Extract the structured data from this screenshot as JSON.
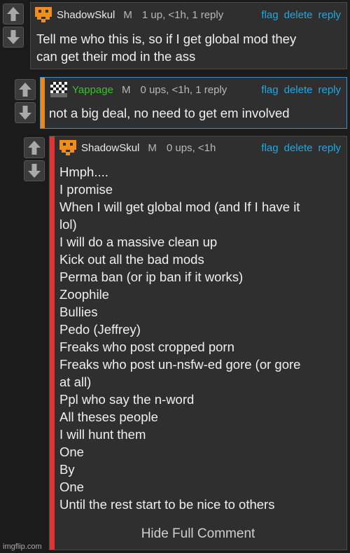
{
  "colors": {
    "link": "#1fa7e6",
    "shadowskul_name": "#e8e8e8",
    "yappage_name": "#3bbf2f",
    "stripe_c2": "#e68a1f",
    "stripe_c3": "#e23232"
  },
  "icons": {
    "upvote": "up-arrow-icon",
    "downvote": "down-arrow-icon"
  },
  "comments": [
    {
      "username": "ShadowSkul",
      "mod_badge": "M",
      "meta": "1 up, <1h, 1 reply",
      "actions": {
        "flag": "flag",
        "delete": "delete",
        "reply": "reply"
      },
      "lines": [
        "Tell me who this is, so if I get global mod they",
        "can get their mod in the ass"
      ]
    },
    {
      "username": "Yappage",
      "mod_badge": "M",
      "meta": "0 ups, <1h, 1 reply",
      "actions": {
        "flag": "flag",
        "delete": "delete",
        "reply": "reply"
      },
      "lines": [
        "not a big deal, no need to get em involved"
      ]
    },
    {
      "username": "ShadowSkul",
      "mod_badge": "M",
      "meta": "0 ups, <1h",
      "actions": {
        "flag": "flag",
        "delete": "delete",
        "reply": "reply"
      },
      "lines": [
        "Hmph....",
        "I promise",
        "When I will get global mod (and If I have it",
        "lol)",
        "I will do a massive clean up",
        "Kick out all the bad mods",
        "Perma ban (or ip ban if it works)",
        "Zoophile",
        "Bullies",
        "Pedo (Jeffrey)",
        "Freaks who post cropped porn",
        "Freaks who post un-nsfw-ed gore (or gore",
        "at all)",
        "Ppl who say the n-word",
        "All theses people",
        "I will hunt them",
        "One",
        "By",
        "One",
        "Until the rest start to be nice to others"
      ],
      "hide_full_label": "Hide Full Comment"
    }
  ],
  "watermark": "imgflip.com"
}
